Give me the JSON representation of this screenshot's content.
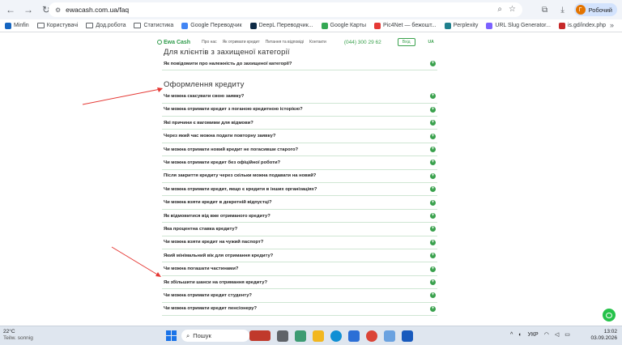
{
  "browser": {
    "url": "ewacash.com.ua/faq",
    "profile_initial": "Г",
    "profile_label": "Робочий"
  },
  "bookmarks": [
    {
      "label": "Minfin",
      "icon": "minfin-icon",
      "color": "#1565c0"
    },
    {
      "label": "Користувачі",
      "icon": "folder-icon",
      "color": ""
    },
    {
      "label": "Дод.робота",
      "icon": "folder-icon",
      "color": ""
    },
    {
      "label": "Статистика",
      "icon": "folder-icon",
      "color": ""
    },
    {
      "label": "Google Переводчик",
      "icon": "google-translate-icon",
      "color": "#4285f4"
    },
    {
      "label": "DeepL Переводчик...",
      "icon": "deepl-icon",
      "color": "#0f2b46"
    },
    {
      "label": "Google Карты",
      "icon": "google-maps-icon",
      "color": "#34a853"
    },
    {
      "label": "Pic4Net — бежошт...",
      "icon": "pic4net-icon",
      "color": "#e53935"
    },
    {
      "label": "Perplexity",
      "icon": "perplexity-icon",
      "color": "#20808d"
    },
    {
      "label": "URL Slug Generator...",
      "icon": "slug-generator-icon",
      "color": "#7b61ff"
    },
    {
      "label": "is.gd/index.php",
      "icon": "isgd-icon",
      "color": "#c62828"
    }
  ],
  "site": {
    "logo": "Ewa Cash",
    "nav": [
      "Про нас",
      "Як отримати кредит",
      "Питання та відповіді",
      "Контакти"
    ],
    "phone": "(044) 300 29 62",
    "login": "Вхід",
    "lang": "UA"
  },
  "sections": [
    {
      "title": "Для клієнтів з захищеної категорії",
      "items": [
        "Як повідомити про належність до захищеної категорії?"
      ]
    },
    {
      "title": "Оформлення кредиту",
      "items": [
        "Чи можна скасувати свою заявку?",
        "Чи можна отримати кредит з поганою кредитною історією?",
        "Які причини є вагомими для відмови?",
        "Через який час можна подати повторну заявку?",
        "Чи можна отримати новий кредит не погасивши старого?",
        "Чи можна отримати кредит без офіційної роботи?",
        "Після закриття кредиту через скільки можна подавати на новий?",
        "Чи можна отримати кредит, якщо є кредити в інших організаціях?",
        "Чи можна взяти кредит в декретній відпустці?",
        "Як відмовитися від вже отриманого кредиту?",
        "Яка процентна ставка кредиту?",
        "Чи можна взяти кредит на чужий паспорт?",
        "Який мінімальний вік для отримання кредиту?",
        "Чи можна погашати частинами?",
        "Як збільшити шанси на отримання кредиту?",
        "Чи можна отримати кредит студенту?",
        "Чи можна отримати кредит пенсіонеру?"
      ]
    }
  ],
  "taskbar": {
    "weather_temp": "22°C",
    "weather_desc": "Teilw. sonnig",
    "search": "Пошук",
    "lang": "УКР",
    "time": "13:02",
    "date": "03.09.2026"
  }
}
